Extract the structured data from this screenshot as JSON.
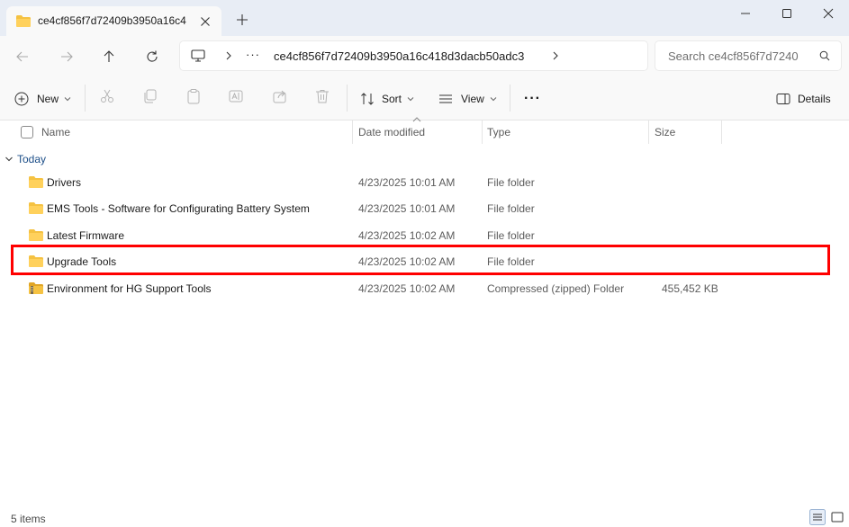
{
  "tab": {
    "title": "ce4cf856f7d72409b3950a16c4",
    "close_icon": "close-icon",
    "new_tab_icon": "plus-icon"
  },
  "window": {
    "minimize_icon": "minimize-icon",
    "maximize_icon": "maximize-icon",
    "close_icon": "close-icon"
  },
  "nav": {
    "back_icon": "arrow-left-icon",
    "forward_icon": "arrow-right-icon",
    "up_icon": "arrow-up-icon",
    "refresh_icon": "refresh-icon",
    "pc_icon": "monitor-icon",
    "overflow": "···",
    "crumb": "ce4cf856f7d72409b3950a16c418d3dacb50adc3"
  },
  "search": {
    "placeholder": "Search ce4cf856f7d7240"
  },
  "toolbar": {
    "new_label": "New",
    "sort_label": "Sort",
    "view_label": "View",
    "more_label": "···",
    "details_label": "Details"
  },
  "columns": {
    "name": "Name",
    "date": "Date modified",
    "type": "Type",
    "size": "Size"
  },
  "group": {
    "label": "Today"
  },
  "rows": [
    {
      "name": "Drivers",
      "date": "4/23/2025 10:01 AM",
      "type": "File folder",
      "size": "",
      "icon": "folder-icon"
    },
    {
      "name": "EMS Tools - Software for Configurating Battery System",
      "date": "4/23/2025 10:01 AM",
      "type": "File folder",
      "size": "",
      "icon": "folder-icon"
    },
    {
      "name": "Latest Firmware",
      "date": "4/23/2025 10:02 AM",
      "type": "File folder",
      "size": "",
      "icon": "folder-icon"
    },
    {
      "name": "Upgrade Tools",
      "date": "4/23/2025 10:02 AM",
      "type": "File folder",
      "size": "",
      "icon": "folder-icon"
    },
    {
      "name": "Environment for HG Support Tools",
      "date": "4/23/2025 10:02 AM",
      "type": "Compressed (zipped) Folder",
      "size": "455,452 KB",
      "icon": "zip-folder-icon"
    }
  ],
  "status": {
    "count": "5 items"
  },
  "colors": {
    "folder": "#f5c242",
    "highlight": "#ff0000",
    "group_label": "#1c4e88",
    "titlebar": "#e8edf5"
  }
}
